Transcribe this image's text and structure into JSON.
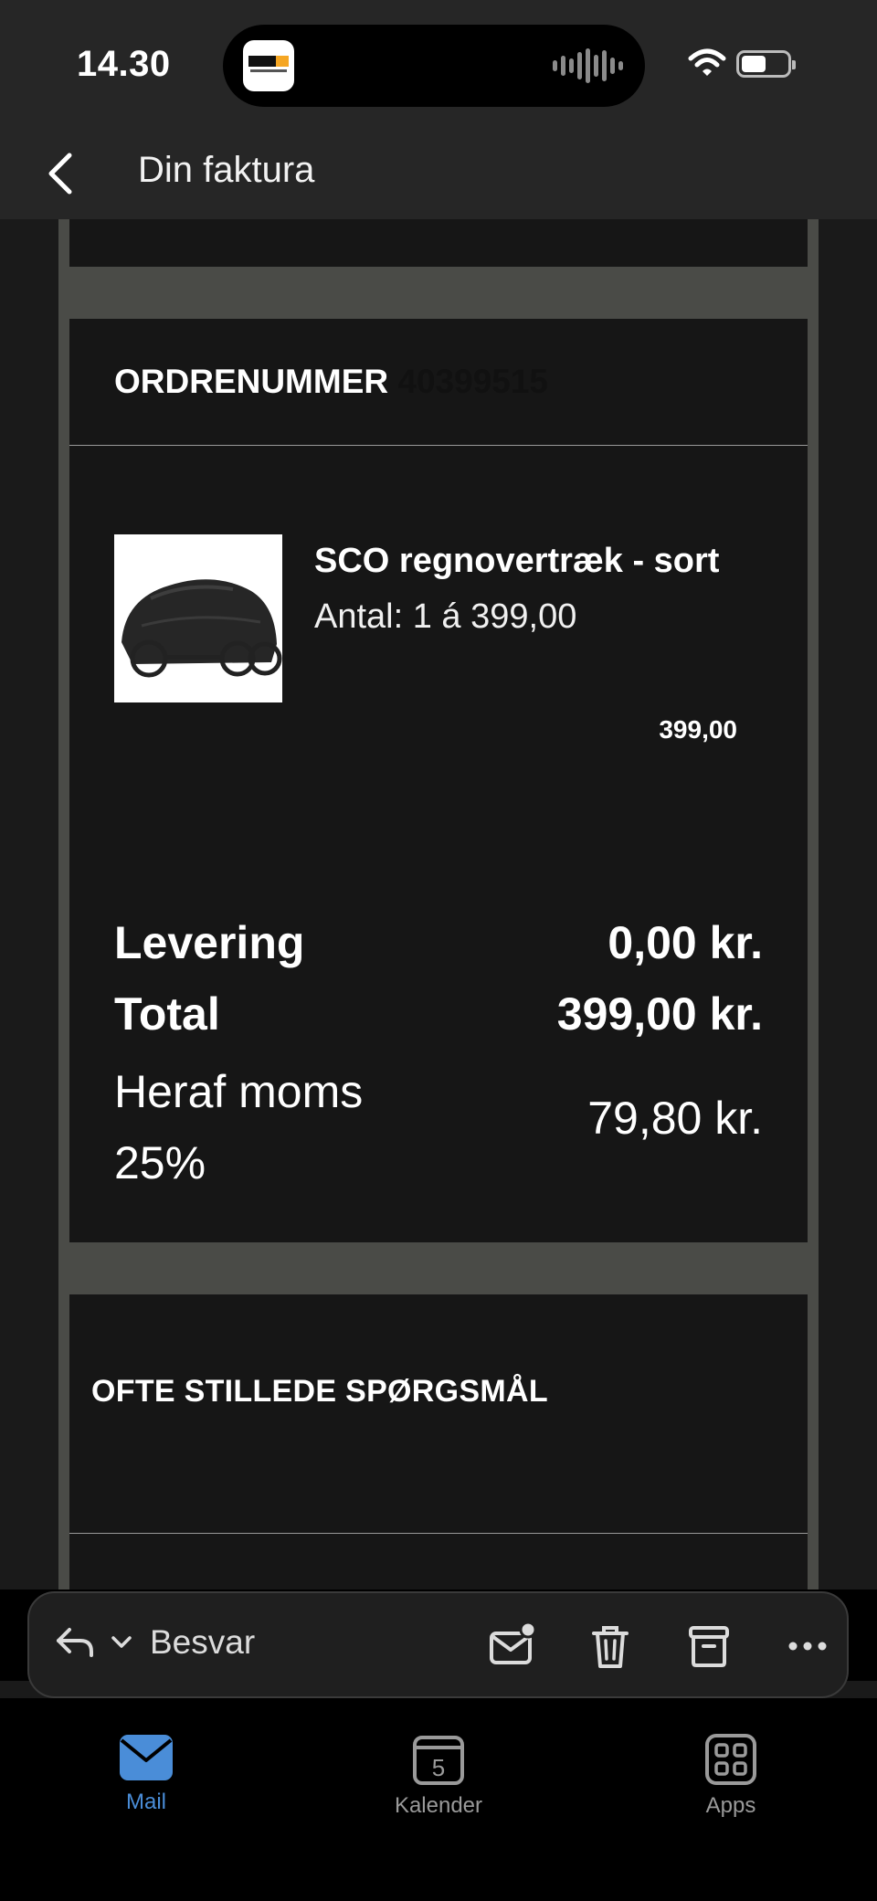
{
  "status_bar": {
    "time": "14.30",
    "island_app_icon": "dr-radio-app-icon",
    "island_activity_icon": "audio-waveform-icon",
    "wifi_icon": "wifi-icon",
    "battery_icon": "battery-icon"
  },
  "header": {
    "back_icon": "chevron-left-icon",
    "title": "Din faktura"
  },
  "email": {
    "order": {
      "label": "ORDRENUMMER",
      "number": "40399515"
    },
    "item": {
      "image_icon": "cargo-bike-rain-cover-image",
      "name": "SCO regnovertræk - sort",
      "quantity": "Antal: 1 á 399,00",
      "line_total": "399,00"
    },
    "summary": {
      "delivery_label": "Levering",
      "delivery_value": "0,00 kr.",
      "total_label": "Total",
      "total_value": "399,00 kr.",
      "vat_label": "Heraf moms 25%",
      "vat_value": "79,80 kr."
    },
    "faq_title": "OFTE STILLEDE SPØRGSMÅL"
  },
  "toolbar": {
    "reply_icon": "reply-icon",
    "reply_menu_icon": "chevron-down-icon",
    "reply_label": "Besvar",
    "mark_unread_icon": "envelope-unread-icon",
    "delete_icon": "trash-icon",
    "archive_icon": "archive-box-icon",
    "more_icon": "ellipsis-icon"
  },
  "tab_bar": {
    "tabs": [
      {
        "label": "Mail",
        "icon": "mail-icon",
        "active": true
      },
      {
        "label": "Kalender",
        "icon": "calendar-icon",
        "badge": "5"
      },
      {
        "label": "Apps",
        "icon": "apps-grid-icon"
      }
    ]
  },
  "colors": {
    "accent": "#4a8dd8",
    "background": "#1a1a1a",
    "panel": "#161616",
    "frame": "#4a4b47",
    "header": "#262626"
  }
}
